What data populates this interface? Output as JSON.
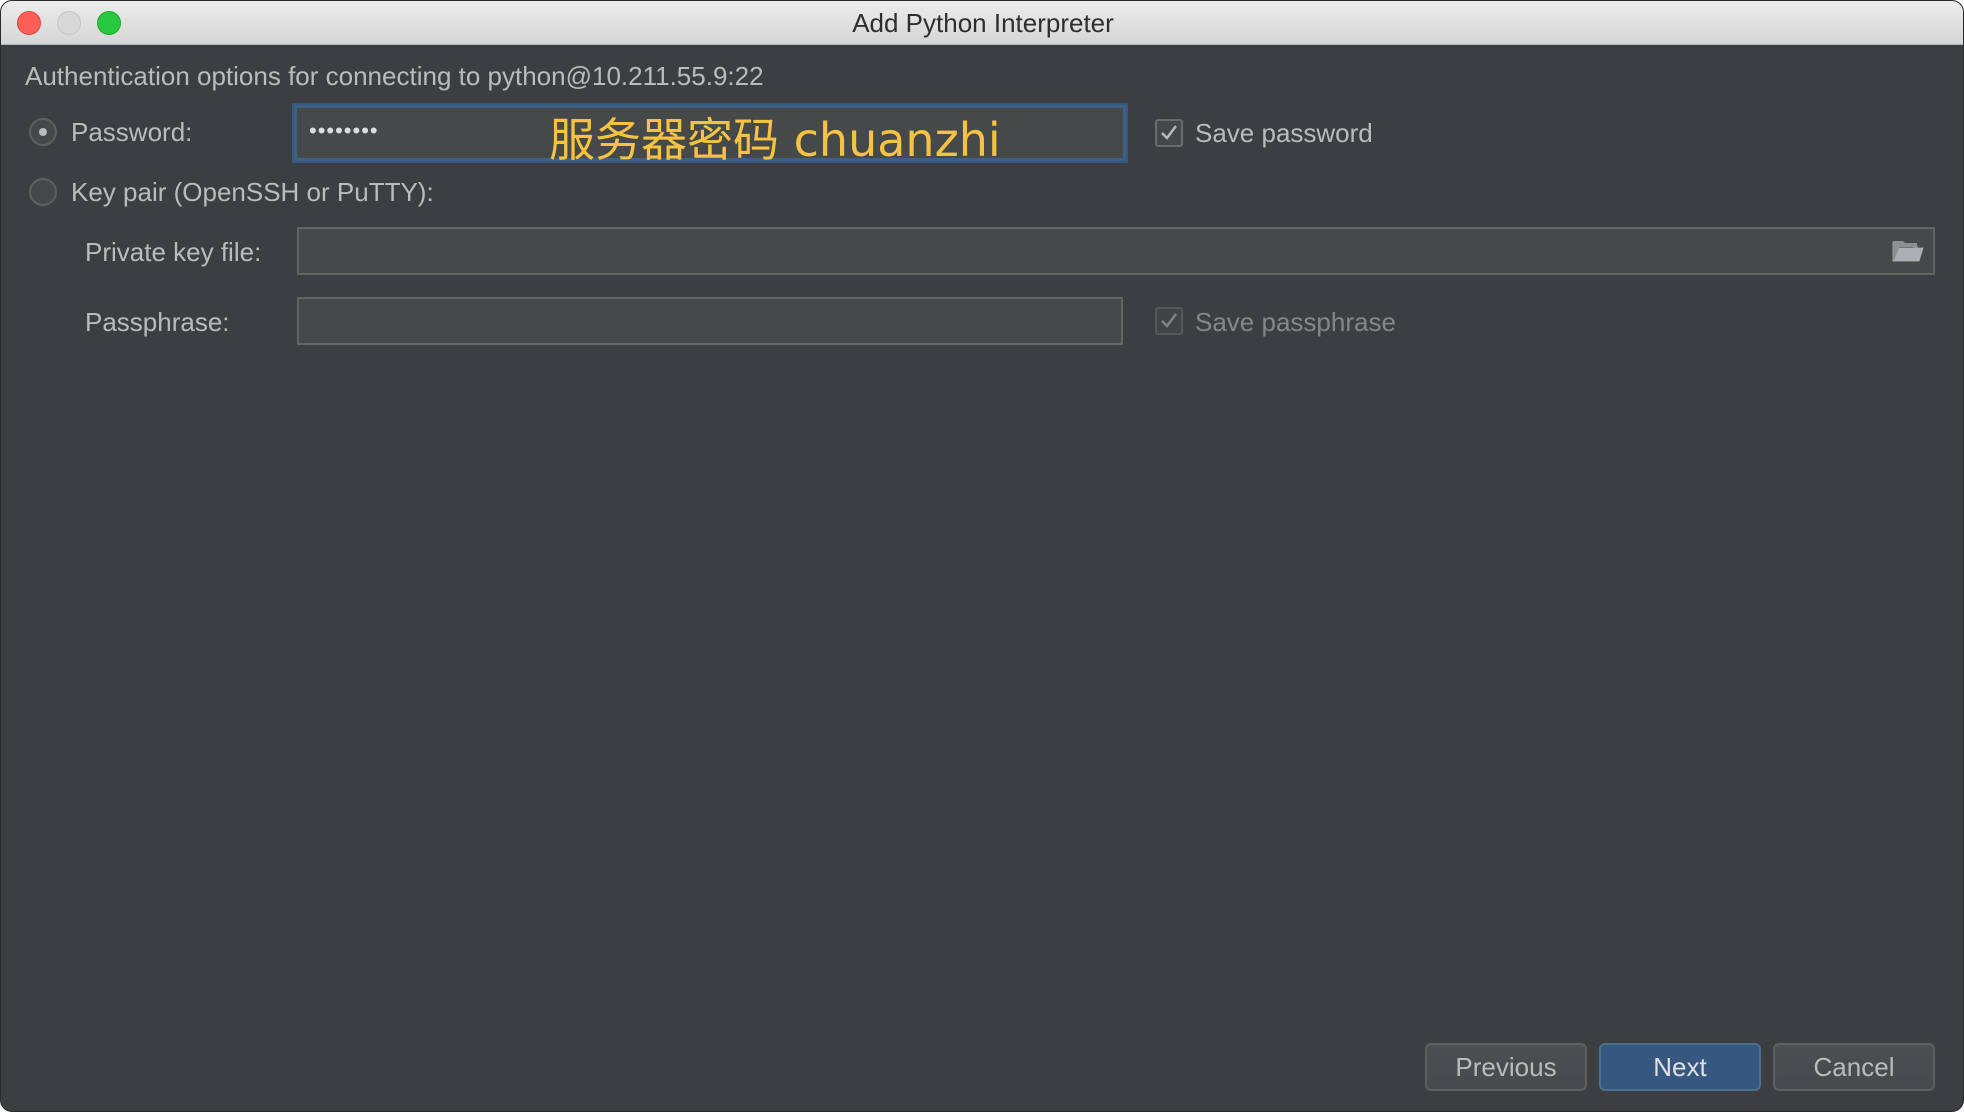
{
  "window": {
    "title": "Add Python Interpreter"
  },
  "auth": {
    "description": "Authentication options for connecting to python@10.211.55.9:22",
    "password_label": "Password:",
    "password_value": "••••••••",
    "password_annotation": "服务器密码  chuanzhi",
    "save_password_label": "Save password",
    "save_password_checked": true,
    "keypair_label": "Key pair (OpenSSH or PuTTY):",
    "private_key_label": "Private key file:",
    "private_key_value": "",
    "passphrase_label": "Passphrase:",
    "passphrase_value": "",
    "save_passphrase_label": "Save passphrase",
    "save_passphrase_checked": true,
    "selected_method": "password"
  },
  "buttons": {
    "previous": "Previous",
    "next": "Next",
    "cancel": "Cancel"
  },
  "icons": {
    "window_controls": [
      "close-icon",
      "minimize-icon",
      "maximize-icon"
    ],
    "browse": "folder-icon",
    "checkmark": "checkmark-icon"
  },
  "colors": {
    "background": "#3c3f41",
    "accent": "#365880",
    "annotation": "#f5c342"
  }
}
